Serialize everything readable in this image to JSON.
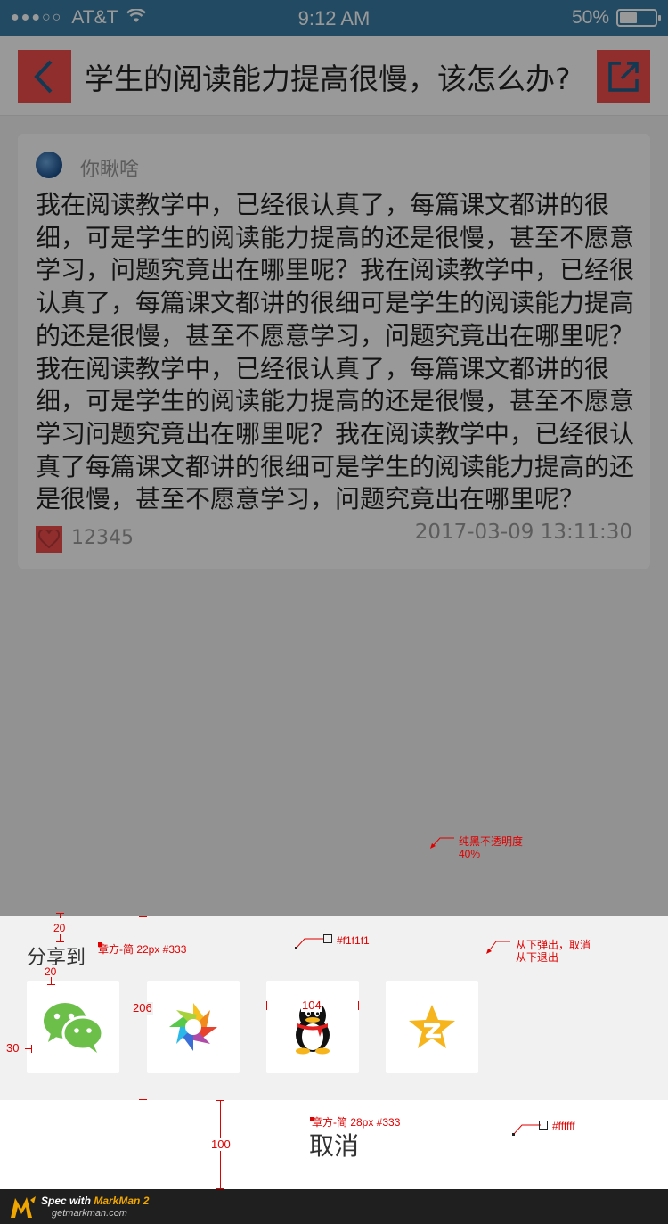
{
  "status_bar": {
    "signal_dots": "●●●○○",
    "carrier": "AT&T",
    "time": "9:12 AM",
    "battery_percent": "50%",
    "battery_level": 0.5
  },
  "nav": {
    "back_icon": "chevron-left-icon",
    "title": "学生的阅读能力提高很慢，该怎么办?",
    "share_icon": "external-share-icon"
  },
  "post": {
    "username": "你瞅啥",
    "content": "我在阅读教学中，已经很认真了，每篇课文都讲的很细，可是学生的阅读能力提高的还是很慢，甚至不愿意学习，问题究竟出在哪里呢？我在阅读教学中，已经很认真了，每篇课文都讲的很细可是学生的阅读能力提高的还是很慢，甚至不愿意学习，问题究竟出在哪里呢？我在阅读教学中，已经很认真了，每篇课文都讲的很细，可是学生的阅读能力提高的还是很慢，甚至不愿意学习问题究竟出在哪里呢？我在阅读教学中，已经很认真了每篇课文都讲的很细可是学生的阅读能力提高的还是很慢，甚至不愿意学习，问题究竟出在哪里呢？",
    "like_count": "12345",
    "date": "2017-03-09 13:11:30"
  },
  "share_sheet": {
    "title": "分享到",
    "targets": [
      {
        "name": "WeChat",
        "icon": "wechat-icon"
      },
      {
        "name": "WeChat Moments",
        "icon": "moments-icon"
      },
      {
        "name": "QQ",
        "icon": "qq-icon"
      },
      {
        "name": "Qzone",
        "icon": "qzone-icon"
      }
    ],
    "cancel_label": "取消"
  },
  "annotations": {
    "overlay_note_1": "纯黑不透明度",
    "overlay_note_2": "40%",
    "gap_top": "20",
    "title_font": "章方-简   22px #333",
    "bg_color_top": "#f1f1f1",
    "motion_note_1": "从下弹出，取消",
    "motion_note_2": "从下退出",
    "gap_title_icon": "20",
    "sheet_height": "206",
    "left_margin": "30",
    "icon_size": "104",
    "cancel_font": "章方-简   28px #333",
    "bg_color_bottom": "#ffffff",
    "cancel_height": "100"
  },
  "markman": {
    "prefix": "Spec with ",
    "brand": "MarkMan 2",
    "url": "getmarkman.com"
  },
  "colors": {
    "accent": "#f04e4e",
    "status_bar": "#3a7ca4",
    "sheet_bg": "#f1f1f1",
    "cancel_bg": "#ffffff",
    "annotation": "#e00000"
  }
}
